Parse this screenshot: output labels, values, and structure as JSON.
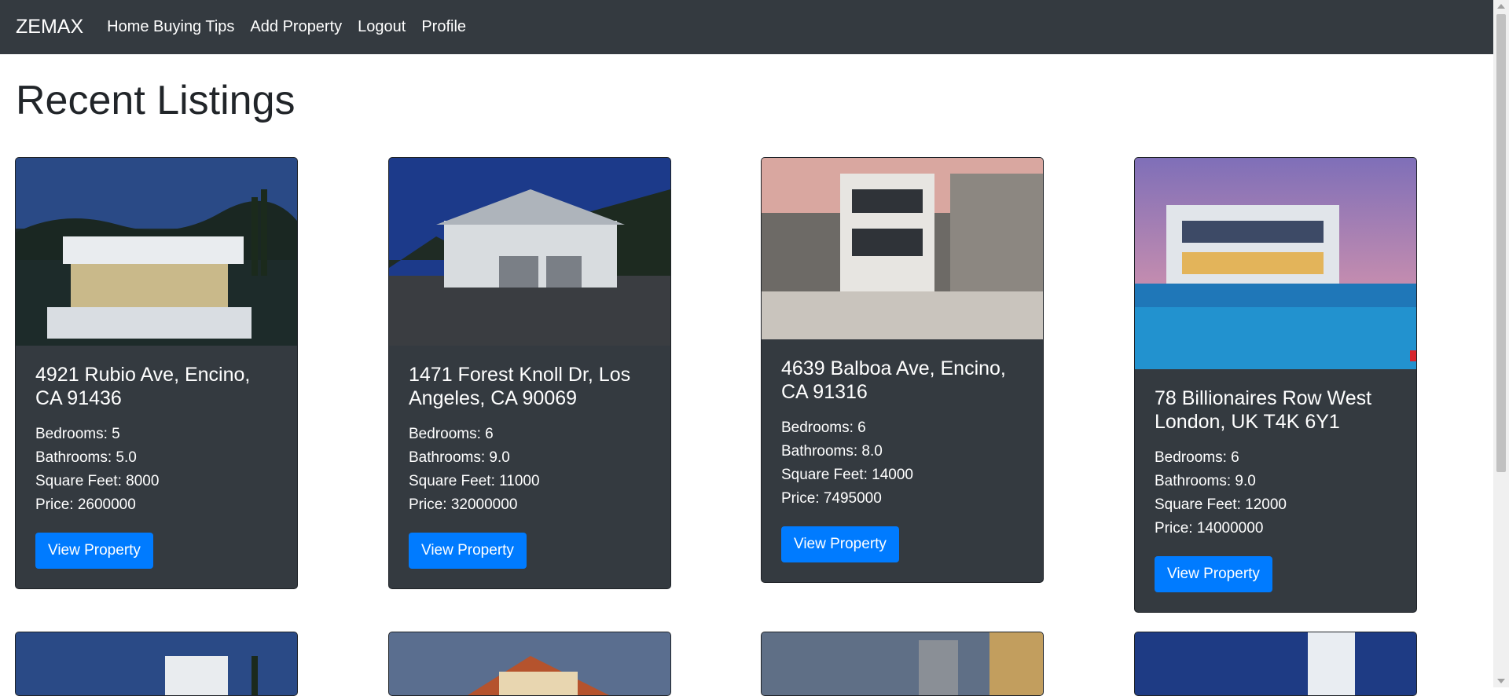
{
  "navbar": {
    "brand": "ZEMAX",
    "links": [
      "Home Buying Tips",
      "Add Property",
      "Logout",
      "Profile"
    ]
  },
  "page_title": "Recent Listings",
  "listings": [
    {
      "title": "4921 Rubio Ave, Encino, CA 91436",
      "bedrooms": "Bedrooms: 5",
      "bathrooms": "Bathrooms: 5.0",
      "sqft": "Square Feet: 8000",
      "price": "Price: 2600000",
      "button": "View Property"
    },
    {
      "title": "1471 Forest Knoll Dr, Los Angeles, CA 90069",
      "bedrooms": "Bedrooms: 6",
      "bathrooms": "Bathrooms: 9.0",
      "sqft": "Square Feet: 11000",
      "price": "Price: 32000000",
      "button": "View Property"
    },
    {
      "title": "4639 Balboa Ave, Encino, CA 91316",
      "bedrooms": "Bedrooms: 6",
      "bathrooms": "Bathrooms: 8.0",
      "sqft": "Square Feet: 14000",
      "price": "Price: 7495000",
      "button": "View Property"
    },
    {
      "title": "78 Billionaires Row West London, UK T4K 6Y1",
      "bedrooms": "Bedrooms: 6",
      "bathrooms": "Bathrooms: 9.0",
      "sqft": "Square Feet: 12000",
      "price": "Price: 14000000",
      "button": "View Property"
    }
  ],
  "colors": {
    "navbar": "#343a40",
    "card": "#343a40",
    "button": "#007bff"
  }
}
